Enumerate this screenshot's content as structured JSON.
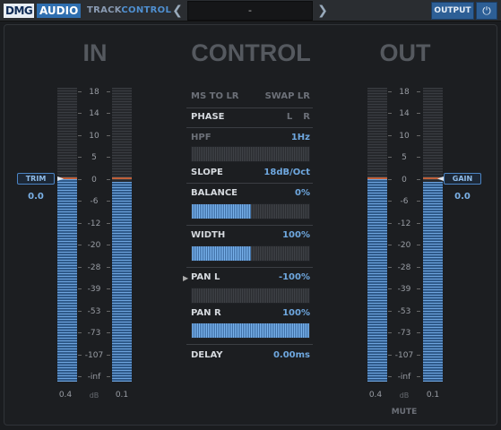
{
  "header": {
    "brand_dmg": "DMG",
    "brand_audio": "AUDIO",
    "product_track": "TRACK",
    "product_control": "CONTROL",
    "preset_name": "-",
    "output_label": "OUTPUT",
    "power_icon": "power-icon",
    "prev_icon": "chevron-left-icon",
    "next_icon": "chevron-right-icon"
  },
  "sections": {
    "in_title": "IN",
    "control_title": "CONTROL",
    "out_title": "OUT"
  },
  "scale_labels": [
    "18",
    "14",
    "10",
    "5",
    "0",
    "-6",
    "-12",
    "-20",
    "-28",
    "-39",
    "-53",
    "-73",
    "-107",
    "-inf"
  ],
  "in_meters": {
    "left_peak": "0.4",
    "right_peak": "0.1",
    "unit": "dB",
    "left_level_fraction": 0.69,
    "right_level_fraction": 0.68
  },
  "out_meters": {
    "left_peak": "0.4",
    "right_peak": "0.1",
    "unit": "dB",
    "left_level_fraction": 0.69,
    "right_level_fraction": 0.68
  },
  "trim": {
    "label": "TRIM",
    "value": "0.0"
  },
  "gain": {
    "label": "GAIN",
    "value": "0.0"
  },
  "controls": {
    "ms_to_lr": "MS TO LR",
    "swap_lr": "SWAP LR",
    "phase_label": "PHASE",
    "phase_l": "L",
    "phase_r": "R",
    "hpf_label": "HPF",
    "hpf_value": "1",
    "hpf_unit": "Hz",
    "hpf_fraction": 0,
    "slope_label": "SLOPE",
    "slope_value": "18",
    "slope_unit": "dB/Oct",
    "balance_label": "BALANCE",
    "balance_value": "0",
    "balance_unit": "%",
    "balance_fraction": 0.5,
    "width_label": "WIDTH",
    "width_value": "100",
    "width_unit": "%",
    "width_fraction": 0.5,
    "pan_l_label": "PAN L",
    "pan_l_value": "-100",
    "pan_l_unit": "%",
    "pan_l_fraction": 0,
    "pan_r_label": "PAN R",
    "pan_r_value": "100",
    "pan_r_unit": "%",
    "pan_r_fraction": 1,
    "delay_label": "DELAY",
    "delay_value": "0.00",
    "delay_unit": "ms"
  },
  "mute_label": "MUTE",
  "colors": {
    "accent": "#2d5f96",
    "meter_blue": "#6ea4de",
    "value_blue": "#6fa8e0",
    "peak_orange": "#c0603a"
  }
}
